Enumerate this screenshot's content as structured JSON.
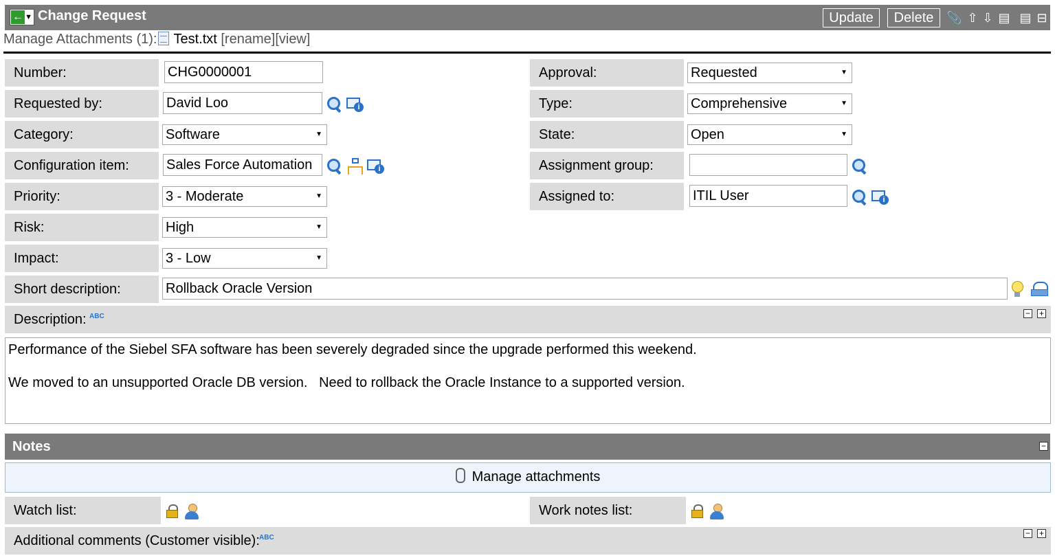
{
  "header": {
    "title": "Change Request",
    "update_label": "Update",
    "delete_label": "Delete"
  },
  "attachments": {
    "prefix": "Manage Attachments (1):",
    "file": "Test.txt",
    "rename": "[rename]",
    "view": "[view]"
  },
  "form": {
    "number": {
      "label": "Number:",
      "value": "CHG0000001"
    },
    "requested_by": {
      "label": "Requested by:",
      "value": "David Loo"
    },
    "category": {
      "label": "Category:",
      "value": "Software"
    },
    "ci": {
      "label": "Configuration item:",
      "value": "Sales Force Automation"
    },
    "priority": {
      "label": "Priority:",
      "value": "3 - Moderate"
    },
    "risk": {
      "label": "Risk:",
      "value": "High"
    },
    "impact": {
      "label": "Impact:",
      "value": "3 - Low"
    },
    "short_desc": {
      "label": "Short description:",
      "value": "Rollback Oracle Version"
    },
    "approval": {
      "label": "Approval:",
      "value": "Requested"
    },
    "type": {
      "label": "Type:",
      "value": "Comprehensive"
    },
    "state": {
      "label": "State:",
      "value": "Open"
    },
    "assignment_group": {
      "label": "Assignment group:",
      "value": ""
    },
    "assigned_to": {
      "label": "Assigned to:",
      "value": "ITIL User"
    }
  },
  "description": {
    "label": "Description:",
    "line1": "Performance of the Siebel SFA software has been severely degraded since the upgrade performed this weekend.",
    "line2": "We moved to an unsupported Oracle DB version.   Need to rollback the Oracle Instance to a supported version."
  },
  "notes": {
    "title": "Notes",
    "manage_attachments": "Manage attachments",
    "watch_list": "Watch list:",
    "work_notes_list": "Work notes list:",
    "additional_comments": "Additional comments (Customer visible):"
  },
  "icons": {
    "spell_check": "ABC"
  }
}
